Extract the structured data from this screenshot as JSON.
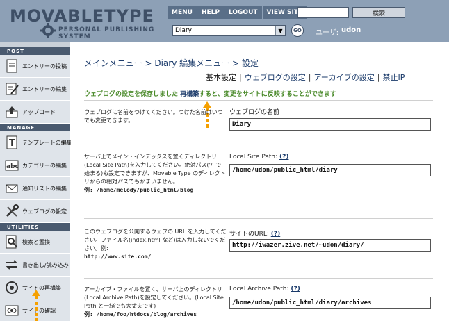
{
  "logo": {
    "title": "MOVABLETYPE",
    "subtitle": "PERSONAL PUBLISHING SYSTEM"
  },
  "topnav": {
    "items": [
      "MENU",
      "HELP",
      "LOGOUT",
      "VIEW SITE"
    ],
    "search_button": "検索",
    "search_value": ""
  },
  "blog_selector": {
    "selected": "Diary",
    "go_label": "GO"
  },
  "user": {
    "label": "ユーザ:",
    "name": "udon"
  },
  "sidebar": {
    "post_heading": "POST",
    "manage_heading": "MANAGE",
    "utilities_heading": "UTILITIES",
    "post_items": [
      {
        "label": "エントリーの投稿",
        "icon": "new-entry-icon"
      },
      {
        "label": "エントリーの編集",
        "icon": "edit-entry-icon"
      },
      {
        "label": "アップロード",
        "icon": "upload-icon"
      }
    ],
    "manage_items": [
      {
        "label": "テンプレートの編集",
        "icon": "template-icon"
      },
      {
        "label": "カテゴリーの編集",
        "icon": "category-icon"
      },
      {
        "label": "通知リストの編集",
        "icon": "notification-icon"
      },
      {
        "label": "ウェブログの設定",
        "icon": "tools-icon"
      }
    ],
    "utility_items": [
      {
        "label": "検索と置換",
        "icon": "search-icon"
      },
      {
        "label": "書き出し/読み込み",
        "icon": "import-export-icon"
      },
      {
        "label": "サイトの再構築",
        "icon": "rebuild-icon"
      },
      {
        "label": "サイトの確認",
        "icon": "view-site-icon"
      }
    ]
  },
  "main": {
    "breadcrumb": {
      "menu": "メインメニュー",
      "sep": " > ",
      "blog": "Diary 編集メニュー",
      "current": "設定"
    },
    "tabs": [
      {
        "label": "基本設定",
        "active": true
      },
      {
        "label": "ウェブログの設定",
        "active": false
      },
      {
        "label": "アーカイブの設定",
        "active": false
      },
      {
        "label": "禁止IP",
        "active": false
      }
    ],
    "notice": {
      "before": "ウェブログの設定を保存しました",
      "link": "再構築",
      "after": "すると、変更をサイトに反映することができます"
    },
    "fields": [
      {
        "desc": "ウェブログに名前をつけてください。つけた名前はいつでも変更できます。",
        "example": "",
        "label": "ウェブログの名前",
        "help": "",
        "value": "Diary"
      },
      {
        "desc": "サーバ上でメイン・インデックスを置くディレクトリ(Local Site Path)を入力してください。絶対パス('/' で始まる)も設定できますが、Movable Type のディレクトリからの相対パスでもかまいません。",
        "example": "例: /home/melody/public_html/blog",
        "label": "Local Site Path:",
        "help": "(?)",
        "value": "/home/udon/public_html/diary"
      },
      {
        "desc": "このウェブログを公開するウェブの URL を入力してください。ファイル名(index.html など)は入力しないでください。例:",
        "example": "http://www.site.com/",
        "label": "サイトのURL:",
        "help": "(?)",
        "value": "http://iwazer.zive.net/~udon/diary/"
      },
      {
        "desc": "アーカイブ・ファイルを置く、サーバ上のディレクトリ(Local Archive Path)を設定してください。(Local Site Path と一緒でも大丈夫です)",
        "example": "例: /home/foo/htdocs/blog/archives",
        "label": "Local Archive Path:",
        "help": "(?)",
        "value": "/home/udon/public_html/diary/archives"
      }
    ]
  },
  "colors": {
    "header_bg": "#8da0b6",
    "sidebar_heading_bg": "#4a5a6f",
    "link": "#1a3a6a",
    "notice": "#4a8a2a",
    "highlight_arrow": "#f5a000"
  }
}
